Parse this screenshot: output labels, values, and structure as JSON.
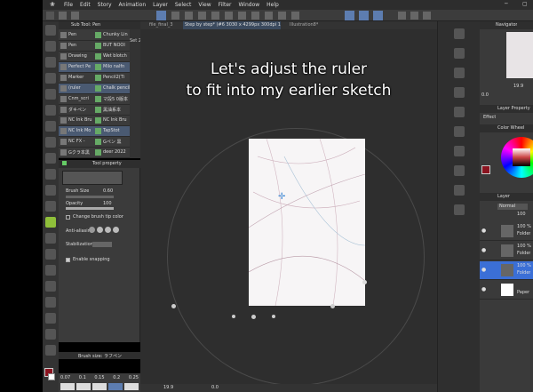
{
  "menu": {
    "items": [
      "File",
      "Edit",
      "Story",
      "Animation",
      "Layer",
      "Select",
      "View",
      "Filter",
      "Window",
      "Help"
    ]
  },
  "canvas_tabs": {
    "tab1": "file_final_3",
    "tab2": "Step by step* (#6 3030 x 4299px 300dpi 19.9%)",
    "tab3": "Illustration8*"
  },
  "overlay_caption": {
    "line1": "Let's adjust the ruler",
    "line2": "to fit into my earlier sketch"
  },
  "subtool_panel": {
    "title": "Sub Tool: Pen",
    "tab": "Set 2",
    "items": [
      {
        "name": "Pen",
        "right": "Chunky Lin"
      },
      {
        "name": "Pen",
        "right": "BUT NOOI"
      },
      {
        "name": "Drawing",
        "right": "Wet blotch"
      },
      {
        "name": "Perfect Pe",
        "right": "Milo nalfn"
      },
      {
        "name": "Marker",
        "right": "Pencil2(Ti"
      },
      {
        "name": "(ruler",
        "right": "Chalk pencil"
      },
      {
        "name": "Cnm_scri",
        "right": "マ段5 0版本"
      },
      {
        "name": "ダキペン",
        "right": "黑油系本"
      },
      {
        "name": "NC Ink Bru",
        "right": "NC Ink Bru"
      },
      {
        "name": "NC Ink Mo",
        "right": "TapStot"
      },
      {
        "name": "NC FX -",
        "right": "Gペン 黒"
      },
      {
        "name": "Gクラ本黒",
        "right": "deer 2022"
      }
    ]
  },
  "tool_property": {
    "title": "Tool property",
    "brush_size_label": "Brush Size",
    "brush_size_value": "0.60",
    "opacity_label": "Opacity",
    "opacity_value": "100",
    "change_tip_label": "Change brush tip color",
    "anti_aliasing_label": "Anti-aliasing",
    "stabilization_label": "Stabilization",
    "enable_snapping_label": "Enable snapping",
    "brush_size_footer": "Brush size: ラフペン",
    "size_presets": [
      "0.07",
      "0.1",
      "0.15",
      "0.2",
      "0.25"
    ]
  },
  "status_bar": {
    "zoom": "19.9",
    "angle": "0.0"
  },
  "right_panels": {
    "navigator_title": "Navigator",
    "nav_zoom": "19.9",
    "nav_angle": "0.0",
    "layer_property_title": "Layer Property",
    "effect_label": "Effect",
    "color_wheel_title": "Color Wheel",
    "layer_title": "Layer",
    "blend_mode": "Normal",
    "opacity": "100",
    "layers": [
      {
        "pct": "100 %",
        "name": "Folder"
      },
      {
        "pct": "100 %",
        "name": "Folder"
      },
      {
        "pct": "100 %",
        "name": "Folder"
      },
      {
        "pct": "",
        "name": "Paper"
      }
    ]
  },
  "colors": {
    "main_color": "#8b1420",
    "accent_blue": "#3b6fd6"
  }
}
